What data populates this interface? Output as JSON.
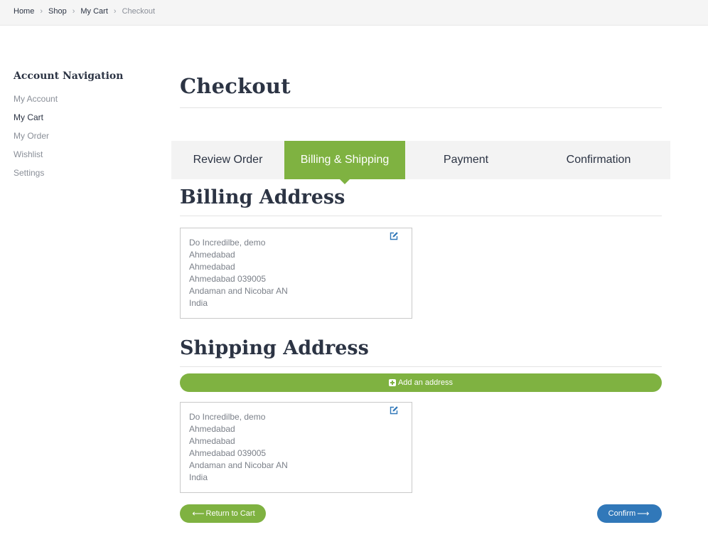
{
  "breadcrumb": {
    "items": [
      "Home",
      "Shop",
      "My Cart"
    ],
    "current": "Checkout"
  },
  "sidebar": {
    "title": "Account Navigation",
    "items": [
      {
        "label": "My Account",
        "active": false
      },
      {
        "label": "My Cart",
        "active": true
      },
      {
        "label": "My Order",
        "active": false
      },
      {
        "label": "Wishlist",
        "active": false
      },
      {
        "label": "Settings",
        "active": false
      }
    ]
  },
  "page": {
    "title": "Checkout"
  },
  "steps": [
    {
      "label": "Review Order",
      "active": false
    },
    {
      "label": "Billing & Shipping",
      "active": true
    },
    {
      "label": "Payment",
      "active": false
    },
    {
      "label": "Confirmation",
      "active": false
    }
  ],
  "billing": {
    "title": "Billing Address",
    "lines": [
      "Do Incredilbe, demo",
      "Ahmedabad",
      "Ahmedabad",
      "Ahmedabad 039005",
      "Andaman and Nicobar AN",
      "India"
    ]
  },
  "shipping": {
    "title": "Shipping Address",
    "add_label": "Add an address",
    "lines": [
      "Do Incredilbe, demo",
      "Ahmedabad",
      "Ahmedabad",
      "Ahmedabad 039005",
      "Andaman and Nicobar AN",
      "India"
    ]
  },
  "actions": {
    "back_label": "Return to Cart",
    "confirm_label": "Confirm"
  },
  "icons": {
    "edit": "edit-icon",
    "plus": "plus-square-icon",
    "arrow_left": "arrow-left-icon",
    "arrow_right": "arrow-right-icon",
    "chevron": "chevron-right-icon"
  },
  "colors": {
    "accent_green": "#7fb241",
    "accent_blue": "#3178b9",
    "text_dark": "#2c3444",
    "text_muted": "#8a8f98"
  }
}
